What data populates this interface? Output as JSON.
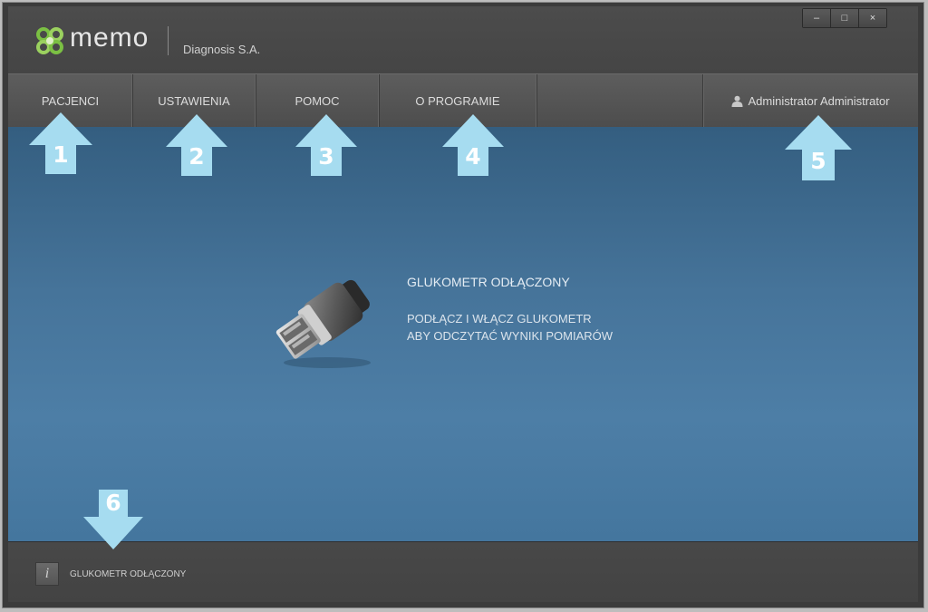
{
  "header": {
    "logo_text": "memo",
    "company": "Diagnosis S.A."
  },
  "window_controls": {
    "minimize": "–",
    "maximize": "□",
    "close": "×"
  },
  "nav": {
    "items": [
      {
        "label": "PACJENCI"
      },
      {
        "label": "USTAWIENIA"
      },
      {
        "label": "POMOC"
      },
      {
        "label": "O PROGRAMIE"
      }
    ],
    "user_label": "Administrator Administrator"
  },
  "main": {
    "title": "GLUKOMETR ODŁĄCZONY",
    "line1": "PODŁĄCZ I WŁĄCZ GLUKOMETR",
    "line2": "ABY ODCZYTAĆ WYNIKI POMIARÓW"
  },
  "status": {
    "icon": "i",
    "text": "GLUKOMETR ODŁĄCZONY"
  },
  "callouts": [
    "1",
    "2",
    "3",
    "4",
    "5",
    "6"
  ],
  "colors": {
    "callout": "#a6dcf0",
    "main_bg": "#46749a",
    "logo_green": "#7bc043"
  }
}
